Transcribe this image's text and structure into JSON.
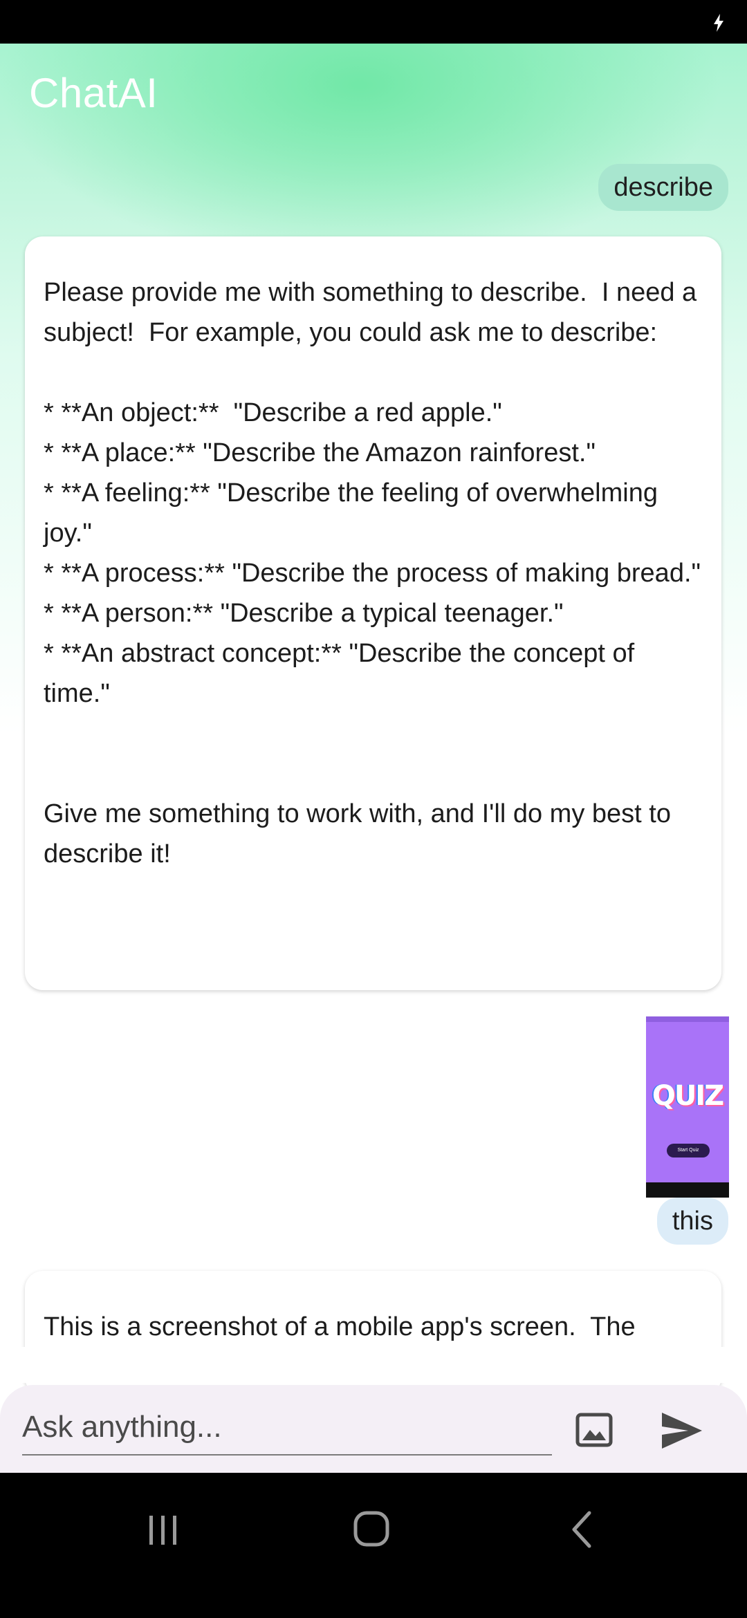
{
  "app": {
    "title": "ChatAI"
  },
  "messages": {
    "user_1": "describe",
    "ai_1": "Please provide me with something to describe.  I need a subject!  For example, you could ask me to describe:\n\n* **An object:**  \"Describe a red apple.\"\n* **A place:** \"Describe the Amazon rainforest.\"\n* **A feeling:** \"Describe the feeling of overwhelming joy.\"\n* **A process:** \"Describe the process of making bread.\"\n* **A person:** \"Describe a typical teenager.\"\n* **An abstract concept:** \"Describe the concept of time.\"\n\n\nGive me something to work with, and I'll do my best to describe it!",
    "user_2_image": {
      "quiz_text": "QUIZ",
      "button_text": "Start Quiz"
    },
    "user_2": "this",
    "ai_2": "This is a screenshot of a mobile app's screen.  The"
  },
  "input": {
    "placeholder": "Ask anything..."
  },
  "icons": {
    "status": "charging-icon",
    "image": "image-icon",
    "send": "send-icon",
    "nav_recents": "recents-icon",
    "nav_home": "home-icon",
    "nav_back": "back-icon"
  },
  "colors": {
    "header_gradient": "#6ee7a5",
    "user_bubble_1": "#a8e6cf",
    "user_bubble_2": "#dcecf8",
    "input_bar": "#f4eff6"
  }
}
